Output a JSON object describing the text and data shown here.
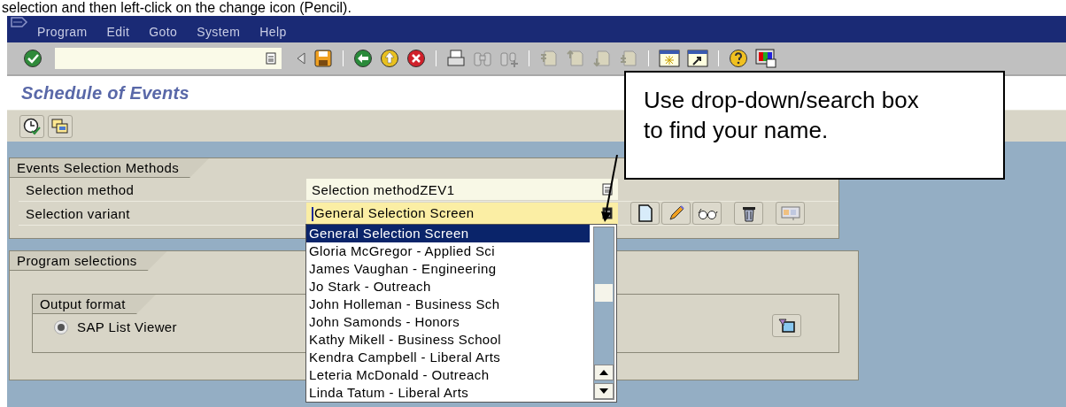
{
  "document_text": "selection and then left-click on the change icon (Pencil).",
  "menu": [
    {
      "label": "Program"
    },
    {
      "label": "Edit"
    },
    {
      "label": "Goto"
    },
    {
      "label": "System"
    },
    {
      "label": "Help"
    }
  ],
  "screen_title": "Schedule of Events",
  "events_selection": {
    "title": "Events Selection Methods",
    "rows": [
      {
        "label": "Selection method",
        "value": "Selection methodZEV1",
        "focused": false
      },
      {
        "label": "Selection variant",
        "value": "General Selection Screen",
        "focused": true
      }
    ]
  },
  "dropdown": {
    "items": [
      {
        "label": "General Selection Screen",
        "selected": true
      },
      {
        "label": "Gloria McGregor - Applied Sci",
        "selected": false
      },
      {
        "label": "James Vaughan - Engineering",
        "selected": false
      },
      {
        "label": "Jo Stark - Outreach",
        "selected": false
      },
      {
        "label": "John Holleman - Business Sch",
        "selected": false
      },
      {
        "label": "John Samonds - Honors",
        "selected": false
      },
      {
        "label": "Kathy Mikell - Business School",
        "selected": false
      },
      {
        "label": "Kendra Campbell - Liberal Arts",
        "selected": false
      },
      {
        "label": "Leteria McDonald - Outreach",
        "selected": false
      },
      {
        "label": "Linda Tatum - Liberal Arts",
        "selected": false
      }
    ]
  },
  "program_selections": {
    "title": "Program selections",
    "output_format": {
      "title": "Output format",
      "options": [
        {
          "label": "SAP List Viewer",
          "selected": true
        }
      ]
    }
  },
  "callout": {
    "text": "Use drop-down/search box to find your name."
  }
}
